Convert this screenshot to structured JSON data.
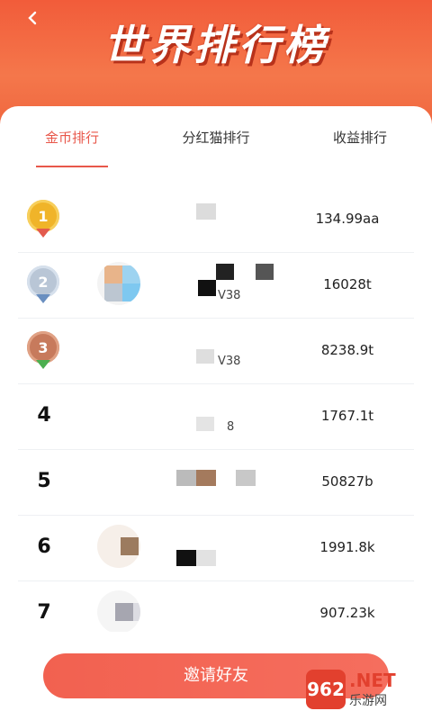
{
  "header": {
    "title": "世界排行榜",
    "back_icon": "chevron-left-icon"
  },
  "tabs": [
    {
      "label": "金币排行",
      "active": true
    },
    {
      "label": "分红猫排行",
      "active": false
    },
    {
      "label": "收益排行",
      "active": false
    }
  ],
  "rows": [
    {
      "rank": "1",
      "medal": "gold",
      "level": "",
      "score": "134.99aa"
    },
    {
      "rank": "2",
      "medal": "silver",
      "level": "V38",
      "score": "16028t"
    },
    {
      "rank": "3",
      "medal": "bronze",
      "level": "V38",
      "score": "8238.9t"
    },
    {
      "rank": "4",
      "medal": "",
      "level": "8",
      "score": "1767.1t"
    },
    {
      "rank": "5",
      "medal": "",
      "level": "",
      "score": "50827b"
    },
    {
      "rank": "6",
      "medal": "",
      "level": "",
      "score": "1991.8k"
    },
    {
      "rank": "7",
      "medal": "",
      "level": "",
      "score": "907.23k"
    }
  ],
  "footer": {
    "invite_label": "邀请好友"
  },
  "watermark": {
    "badge": "962",
    "net": ".NET",
    "site": "乐游网"
  },
  "colors": {
    "accent": "#e8574a",
    "header": "#f0673f",
    "gold": "#f0b429",
    "silver": "#b9c6d6",
    "bronze": "#c77a5c"
  }
}
